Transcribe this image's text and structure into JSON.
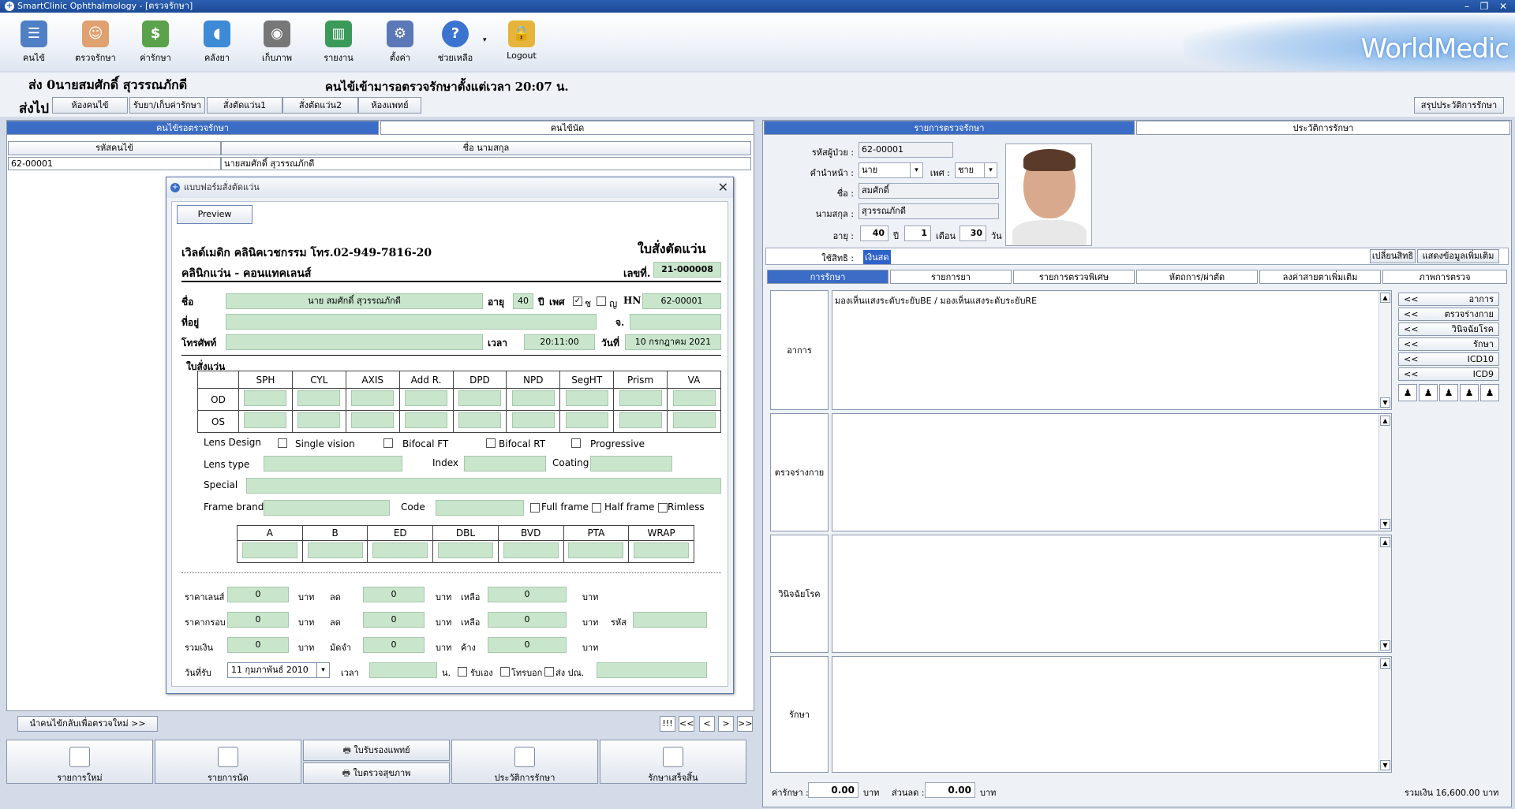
{
  "window": {
    "title": "SmartClinic Ophthalmology - [ตรวจรักษา]"
  },
  "toolbar": {
    "items": [
      "คนไข้",
      "ตรวจรักษา",
      "ค่ารักษา",
      "คลังยา",
      "เก็บภาพ",
      "รายงาน",
      "ตั้งค่า",
      "ช่วยเหลือ",
      "Logout"
    ],
    "logo": "WorldMedic"
  },
  "info": {
    "patient": "ส่ง  0นายสมศักดิ์ สุวรรณภักดี",
    "queue_time": "คนไข้เข้ามารอตรวจรักษาตั้งแต่เวลา 20:07 น."
  },
  "nav": {
    "label": "ส่งไป",
    "buttons": [
      "ห้องคนไข้",
      "รับยา/เก็บค่ารักษา",
      "สั่งตัดแว่น1",
      "สั่งตัดแว่น2",
      "ห้องแพทย์"
    ],
    "summary": "สรุปประวัติการรักษา"
  },
  "left": {
    "tabs": [
      "คนไข้รอตรวจรักษา",
      "คนไข้นัด"
    ],
    "columns": [
      "รหัสคนไข้",
      "ชื่อ นามสกุล"
    ],
    "rows": [
      [
        "62-00001",
        "นายสมศักดิ์ สุวรรณภักดี"
      ]
    ],
    "return_button": "นำคนไข้กลับเพื่อตรวจใหม่ >>",
    "pager": [
      "!!!",
      "<<",
      "<",
      ">",
      ">>"
    ],
    "bottom": {
      "new": "รายการใหม่",
      "appointments": "รายการนัด",
      "doctor_cert": "ใบรับรองแพทย์",
      "health_check": "ใบตรวจสุขภาพ",
      "history": "ประวัติการรักษา",
      "finish": "รักษาเสร็จสิ้น"
    }
  },
  "dialog": {
    "title": "แบบฟอร์มสั่งตัดแว่น",
    "preview": "Preview",
    "clinic": "เวิลด์เมดิก คลินิคเวชกรรม  โทร.02-949-7816-20",
    "sub": "คลินิกแว่น - คอนแทคเลนส์",
    "doc_title": "ใบสั่งตัดแว่น",
    "no_label": "เลขที่.",
    "no": "21-000008",
    "name_label": "ชื่อ",
    "name": "นาย สมศักดิ์   สุวรรณภักดี",
    "age_label": "อายุ",
    "age": "40",
    "year_label": "ปี",
    "sex_label": "เพศ",
    "male": "ช",
    "female": "ญ",
    "hn_label": "HN",
    "hn": "62-00001",
    "addr_label": "ที่อยู่",
    "prov_label": "จ.",
    "phone_label": "โทรศัพท์",
    "time_label": "เวลา",
    "time": "20:11:00",
    "date_label": "วันที่",
    "date": "10 กรกฎาคม 2021",
    "rx_label": "ใบสั่งแว่น",
    "rx_cols": [
      "SPH",
      "CYL",
      "AXIS",
      "Add R.",
      "DPD",
      "NPD",
      "SegHT",
      "Prism",
      "VA"
    ],
    "rx_rows": [
      "OD",
      "OS"
    ],
    "lens_design": "Lens Design",
    "designs": [
      "Single vision",
      "Bifocal FT",
      "Bifocal RT",
      "Progressive"
    ],
    "lens_type": "Lens type",
    "index": "Index",
    "coating": "Coating",
    "special": "Special",
    "frame_brand": "Frame brand",
    "code": "Code",
    "frames": [
      "Full frame",
      "Half frame",
      "Rimless"
    ],
    "frame_cols": [
      "A",
      "B",
      "ED",
      "DBL",
      "BVD",
      "PTA",
      "WRAP"
    ],
    "price_rows": [
      {
        "label": "ราคาเลนส์",
        "v1": "0",
        "u1": "บาท",
        "l2": "ลด",
        "v2": "0",
        "u2": "บาท",
        "l3": "เหลือ",
        "v3": "0",
        "u3": "บาท"
      },
      {
        "label": "ราคากรอบ",
        "v1": "0",
        "u1": "บาท",
        "l2": "ลด",
        "v2": "0",
        "u2": "บาท",
        "l3": "เหลือ",
        "v3": "0",
        "u3": "บาท"
      },
      {
        "label": "รวมเงิน",
        "v1": "0",
        "u1": "บาท",
        "l2": "มัดจำ",
        "v2": "0",
        "u2": "บาท",
        "l3": "ค้าง",
        "v3": "0",
        "u3": "บาท"
      }
    ],
    "code_label": "รหัส",
    "receive_label": "วันที่รับ",
    "receive_date": "11  กุมภาพันธ์  2010",
    "receive_time_label": "เวลา",
    "unit_n": "น.",
    "pickup": [
      "รับเอง",
      "โทรบอก",
      "ส่ง ปณ."
    ]
  },
  "right": {
    "tabs": [
      "รายการตรวจรักษา",
      "ประวัติการรักษา"
    ],
    "pid_label": "รหัสผู้ป่วย :",
    "pid": "62-00001",
    "prefix_label": "คำนำหน้า :",
    "prefix": "นาย",
    "sex_label": "เพศ :",
    "sex": "ชาย",
    "fname_label": "ชื่อ :",
    "fname": "สมศักดิ์",
    "lname_label": "นามสกุล :",
    "lname": "สุวรรณภักดี",
    "age_label": "อายุ :",
    "age_y": "40",
    "y": "ปี",
    "age_m": "1",
    "m": "เดือน",
    "age_d": "30",
    "d": "วัน",
    "rights_label": "ใช้สิทธิ :",
    "rights_value": "เงินสด",
    "change_rights": "เปลี่ยนสิทธิ",
    "more_info": "แสดงข้อมูลเพิ่มเติม",
    "subtabs": [
      "การรักษา",
      "รายการยา",
      "รายการตรวจพิเศษ",
      "หัตถการ/ผ่าตัด",
      "ลงค่าสายตาเพิ่มเติม",
      "ภาพการตรวจ"
    ],
    "sections": [
      {
        "label": "อาการ",
        "text": "มองเห็นแสงระดับระยับBE / มองเห็นแสงระดับระยับRE"
      },
      {
        "label": "ตรวจร่างกาย",
        "text": ""
      },
      {
        "label": "วินิจฉัยโรค",
        "text": ""
      },
      {
        "label": "รักษา",
        "text": ""
      }
    ],
    "side_buttons": [
      "อาการ",
      "ตรวจร่างกาย",
      "วินิจฉัยโรค",
      "รักษา",
      "ICD10",
      "ICD9"
    ],
    "side_arrow": "<<",
    "fee_label": "ค่ารักษา :",
    "fee": "0.00",
    "baht": "บาท",
    "discount_label": "ส่วนลด :",
    "discount": "0.00",
    "total": "รวมเงิน 16,600.00 บาท"
  }
}
